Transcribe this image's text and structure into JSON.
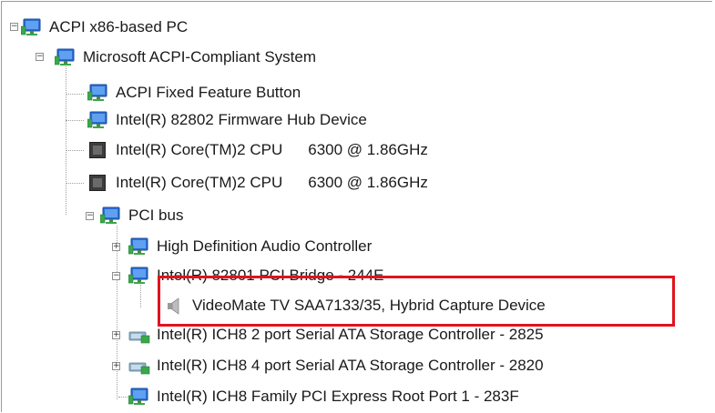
{
  "tree": {
    "root": {
      "label": "ACPI x86-based PC"
    },
    "system": {
      "label": "Microsoft ACPI-Compliant System"
    },
    "system_children": [
      {
        "label": "ACPI Fixed Feature Button",
        "icon": "device-monitor-icon"
      },
      {
        "label": "Intel(R) 82802 Firmware Hub Device",
        "icon": "device-monitor-icon"
      },
      {
        "label": "Intel(R) Core(TM)2 CPU",
        "speed": "6300  @ 1.86GHz",
        "icon": "processor-icon"
      },
      {
        "label": "Intel(R) Core(TM)2 CPU",
        "speed": "6300  @ 1.86GHz",
        "icon": "processor-icon"
      }
    ],
    "pci_bus": {
      "label": "PCI bus"
    },
    "pci_children": [
      {
        "label": "High Definition Audio Controller",
        "icon": "device-monitor-icon"
      },
      {
        "label": "Intel(R) 82801 PCI Bridge - 244E",
        "icon": "device-monitor-icon"
      },
      {
        "label": "Intel(R) ICH8 2 port Serial ATA Storage Controller - 2825",
        "icon": "storage-controller-icon"
      },
      {
        "label": "Intel(R) ICH8 4 port Serial ATA Storage Controller - 2820",
        "icon": "storage-controller-icon"
      },
      {
        "label": "Intel(R) ICH8 Family PCI Express Root Port 1 - 283F",
        "icon": "device-monitor-icon"
      }
    ],
    "bridge_child": {
      "label": "VideoMate TV SAA7133/35, Hybrid Capture Device",
      "icon": "speaker-icon"
    }
  },
  "colors": {
    "highlight": "#e0141e",
    "monitor_blue": "#1e5fc8",
    "monitor_green": "#3aa84a"
  }
}
